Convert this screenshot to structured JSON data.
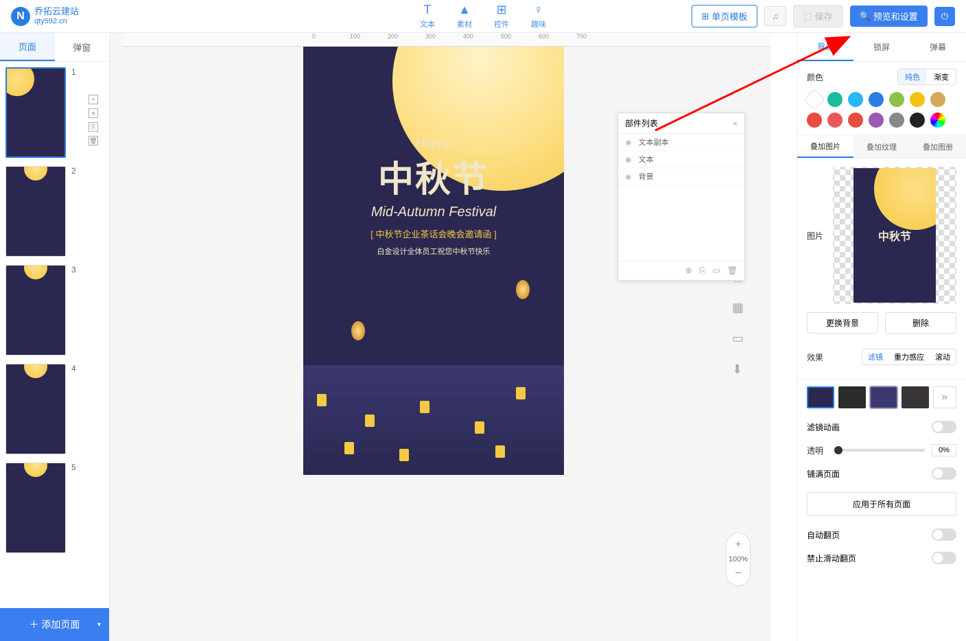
{
  "logo": {
    "name": "乔拓云建站",
    "sub": "qty592.cn"
  },
  "header_tools": [
    {
      "label": "文本",
      "icon": "T"
    },
    {
      "label": "素材",
      "icon": "▲"
    },
    {
      "label": "控件",
      "icon": "⊞"
    },
    {
      "label": "趣味",
      "icon": "♀"
    }
  ],
  "header_buttons": {
    "template": "单页模板",
    "save": "保存",
    "preview": "预览和设置"
  },
  "left_tabs": {
    "pages": "页面",
    "popup": "弹窗"
  },
  "add_page": "＋ 添加页面",
  "pages": [
    1,
    2,
    3,
    4,
    5
  ],
  "ruler": [
    "0",
    "100",
    "200",
    "300",
    "400",
    "500",
    "600",
    "700"
  ],
  "canvas": {
    "happy": "Happy",
    "main": "中秋节",
    "sub": "Mid-Autumn Festival",
    "invite": "[ 中秋节企业茶话会晚会邀请函 ]",
    "greeting": "白金设计全体员工祝您中秋节快乐"
  },
  "zoom": "100%",
  "widget": {
    "title": "部件列表",
    "items": [
      "文本副本",
      "文本",
      "背景"
    ]
  },
  "right_tabs": {
    "bg": "背景",
    "lock": "锁屏",
    "barrage": "弹幕"
  },
  "props": {
    "color": "颜色",
    "color_tabs": {
      "solid": "纯色",
      "gradient": "渐变"
    },
    "sub_tabs": {
      "img": "叠加图片",
      "tex": "叠加纹理",
      "album": "叠加图册"
    },
    "pic": "图片",
    "change_bg": "更换背景",
    "delete": "删除",
    "effect": "效果",
    "effect_tabs": {
      "filter": "滤镜",
      "gravity": "重力感应",
      "scroll": "滚动"
    },
    "filter_anim": "滤镜动画",
    "opacity": "透明",
    "opacity_val": "0%",
    "fill": "铺满页面",
    "apply_all": "应用于所有页面",
    "auto_flip": "自动翻页",
    "no_swipe": "禁止滑动翻页"
  },
  "colors": [
    "#fff",
    "#1abc9c",
    "#3498db",
    "#2a7de1",
    "#8bc34a",
    "#f1c40f",
    "#d4a857",
    "#e74c3c",
    "#e74c60",
    "#e74c3c",
    "#9b59b6",
    "#888",
    "#222",
    "rainbow"
  ]
}
